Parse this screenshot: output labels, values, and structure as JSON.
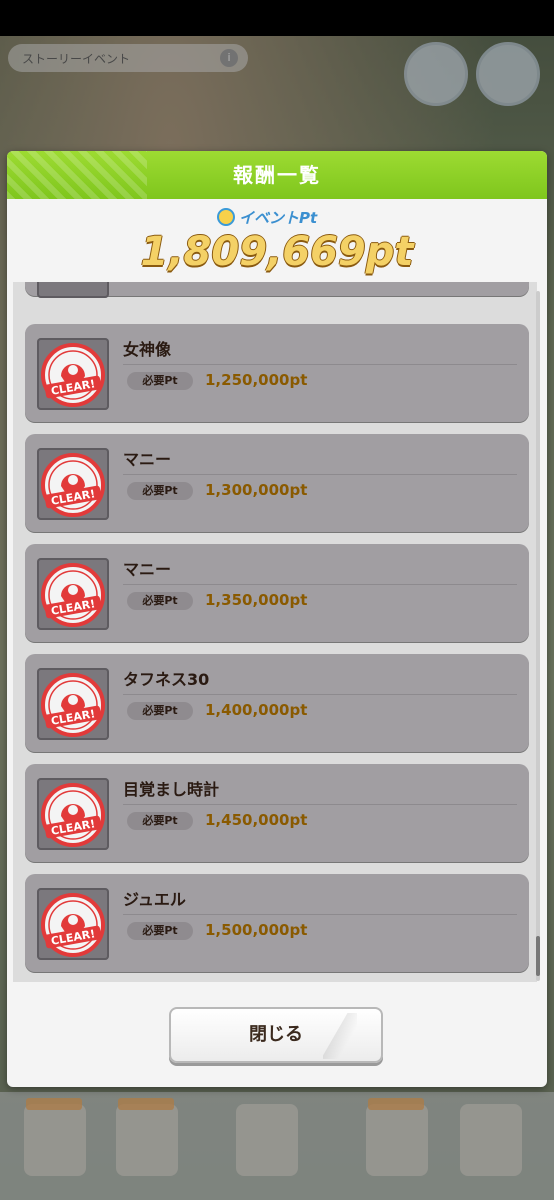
{
  "background": {
    "story_event_label": "ストーリーイベント",
    "info_glyph": "i"
  },
  "dialog": {
    "title": "報酬一覧",
    "point_label": "イベントPt",
    "point_total": "1,809,669pt",
    "required_label": "必要Pt",
    "clear_text": "CLEAR!",
    "items": [
      {
        "name": "女神像",
        "required": "1,250,000pt",
        "status": "clear"
      },
      {
        "name": "マニー",
        "required": "1,300,000pt",
        "status": "clear"
      },
      {
        "name": "マニー",
        "required": "1,350,000pt",
        "status": "clear"
      },
      {
        "name": "タフネス30",
        "required": "1,400,000pt",
        "status": "clear"
      },
      {
        "name": "目覚まし時計",
        "required": "1,450,000pt",
        "status": "clear"
      },
      {
        "name": "ジュエル",
        "required": "1,500,000pt",
        "status": "clear"
      }
    ],
    "close_label": "閉じる"
  },
  "colors": {
    "header_green": "#8fd226",
    "card_grey": "#a19ea2",
    "value_gold": "#8a5a00",
    "stamp_red": "#e23a3a"
  }
}
